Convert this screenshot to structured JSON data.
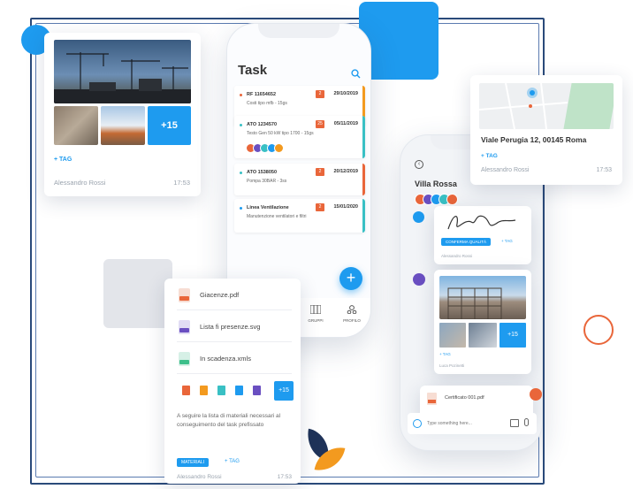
{
  "colors": {
    "accent": "#1e9bef",
    "orange": "#e9663a",
    "teal": "#39c0c4",
    "purple": "#6a4fc1",
    "navy": "#2a4a7a"
  },
  "photo_card": {
    "more_count": "+15",
    "tag_label": "+ TAG",
    "author": "Alessandro Rossi",
    "time": "17:53"
  },
  "task_phone": {
    "title": "Task",
    "tasks": [
      {
        "code": "RF 11654652",
        "desc": "Costi tipo mfb - 15gs",
        "date": "29/10/2019",
        "priority": "2"
      },
      {
        "code": "ATO 1234570",
        "desc": "Testo Gen 50 kW tipo 1700 - 15gs",
        "date": "05/11/2019",
        "priority": "25"
      },
      {
        "code": "ATO 1538050",
        "desc": "Pompa 30BAR - 3ss",
        "date": "20/12/2019",
        "priority": "2"
      },
      {
        "code": "Linea Ventilazione",
        "desc": "Manutenzione ventilatori e filtri",
        "date": "15/01/2020",
        "priority": "2"
      }
    ],
    "nav": {
      "groups": "GRUPPI",
      "profile": "PROFILO"
    },
    "fab": "+"
  },
  "files_card": {
    "files": [
      "Giacenze.pdf",
      "Lista fi presenze.svg",
      "In scadenza.xmls"
    ],
    "more_count": "+15",
    "note": "A seguire la lista di materiali necessari al conseguimento del task prefissato",
    "tag_pill": "MATERIALI",
    "tag_label": "+ TAG",
    "author": "Alessandro Rossi",
    "time": "17:53"
  },
  "chat_phone": {
    "title": "Villa Rossa",
    "sig_tag": "CONFERMA QUALITÀ",
    "tag_label": "+ TAG",
    "sig_author": "Alessandro Rossi",
    "photo_more": "+15",
    "photo_tag": "+ TAG",
    "photo_author": "Luca Pozinetti",
    "file_name": "Certificato 001.pdf",
    "input_placeholder": "Type something here..."
  },
  "map_card": {
    "address": "Viale Perugia 12, 00145 Roma",
    "tag_label": "+ TAG",
    "author": "Alessandro Rossi",
    "time": "17:53"
  }
}
